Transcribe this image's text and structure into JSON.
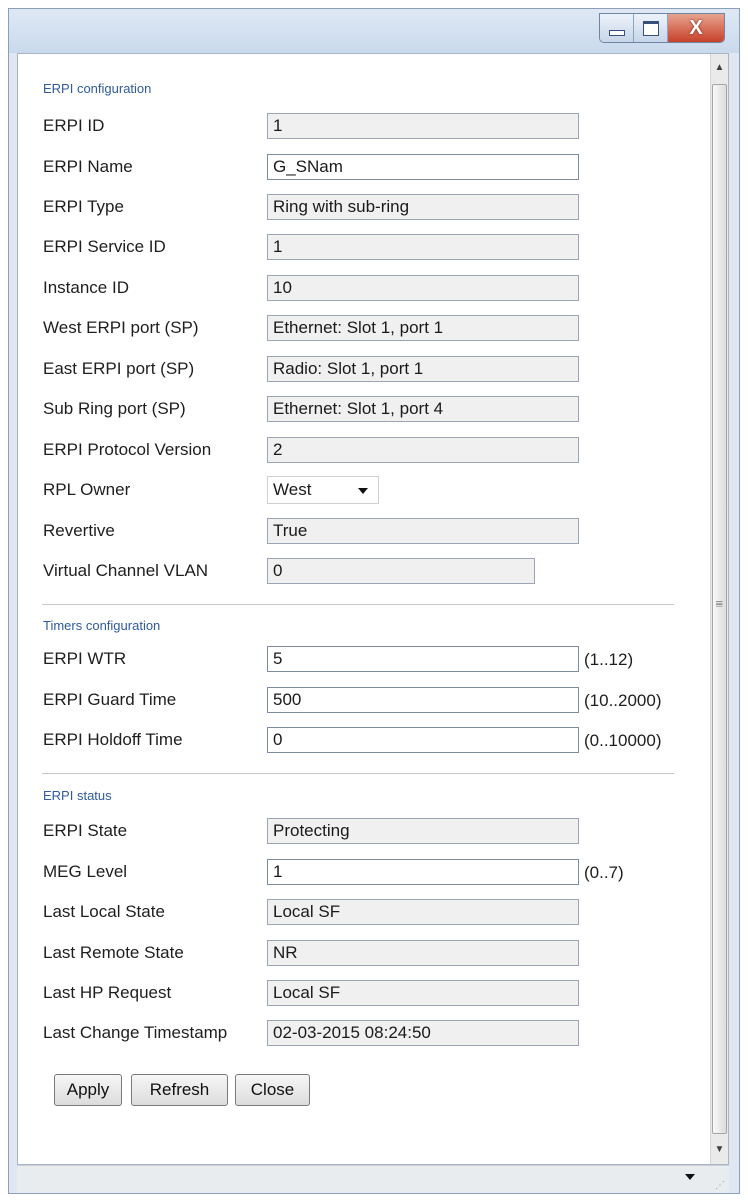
{
  "window": {
    "controls": {
      "minimize_icon": "minimize-icon",
      "maximize_icon": "maximize-icon",
      "close_label": "X"
    }
  },
  "sections": {
    "config_title": "ERPI configuration",
    "timers_title": "Timers configuration",
    "status_title": "ERPI status"
  },
  "config": [
    {
      "label": "ERPI ID",
      "value": "1",
      "type": "readonly"
    },
    {
      "label": "ERPI Name",
      "value": "G_SNam",
      "type": "input"
    },
    {
      "label": "ERPI Type",
      "value": "Ring with sub-ring",
      "type": "readonly"
    },
    {
      "label": "ERPI Service ID",
      "value": "1",
      "type": "readonly"
    },
    {
      "label": "Instance ID",
      "value": "10",
      "type": "readonly"
    },
    {
      "label": "West ERPI port (SP)",
      "value": "Ethernet: Slot 1, port 1",
      "type": "readonly"
    },
    {
      "label": "East ERPI port (SP)",
      "value": "Radio: Slot 1, port 1",
      "type": "readonly"
    },
    {
      "label": "Sub Ring port (SP)",
      "value": "Ethernet: Slot 1, port 4",
      "type": "readonly"
    },
    {
      "label": "ERPI Protocol Version",
      "value": "2",
      "type": "readonly"
    },
    {
      "label": "RPL Owner",
      "value": "West",
      "type": "select"
    },
    {
      "label": "Revertive",
      "value": "True",
      "type": "readonly"
    },
    {
      "label": "Virtual Channel VLAN",
      "value": "0",
      "type": "readonly"
    }
  ],
  "timers": [
    {
      "label": "ERPI WTR",
      "value": "5",
      "range": "(1..12)"
    },
    {
      "label": "ERPI Guard Time",
      "value": "500",
      "range": "(10..2000)"
    },
    {
      "label": "ERPI Holdoff Time",
      "value": "0",
      "range": "(0..10000)"
    }
  ],
  "status": [
    {
      "label": "ERPI State",
      "value": "Protecting",
      "type": "readonly"
    },
    {
      "label": "MEG Level",
      "value": "1",
      "type": "input",
      "range": "(0..7)"
    },
    {
      "label": "Last Local State",
      "value": "Local SF",
      "type": "readonly"
    },
    {
      "label": "Last Remote State",
      "value": "NR",
      "type": "readonly"
    },
    {
      "label": "Last HP Request",
      "value": "Local SF",
      "type": "readonly"
    },
    {
      "label": "Last Change Timestamp",
      "value": "02-03-2015 08:24:50",
      "type": "readonly"
    }
  ],
  "buttons": {
    "apply": "Apply",
    "refresh": "Refresh",
    "close": "Close"
  }
}
